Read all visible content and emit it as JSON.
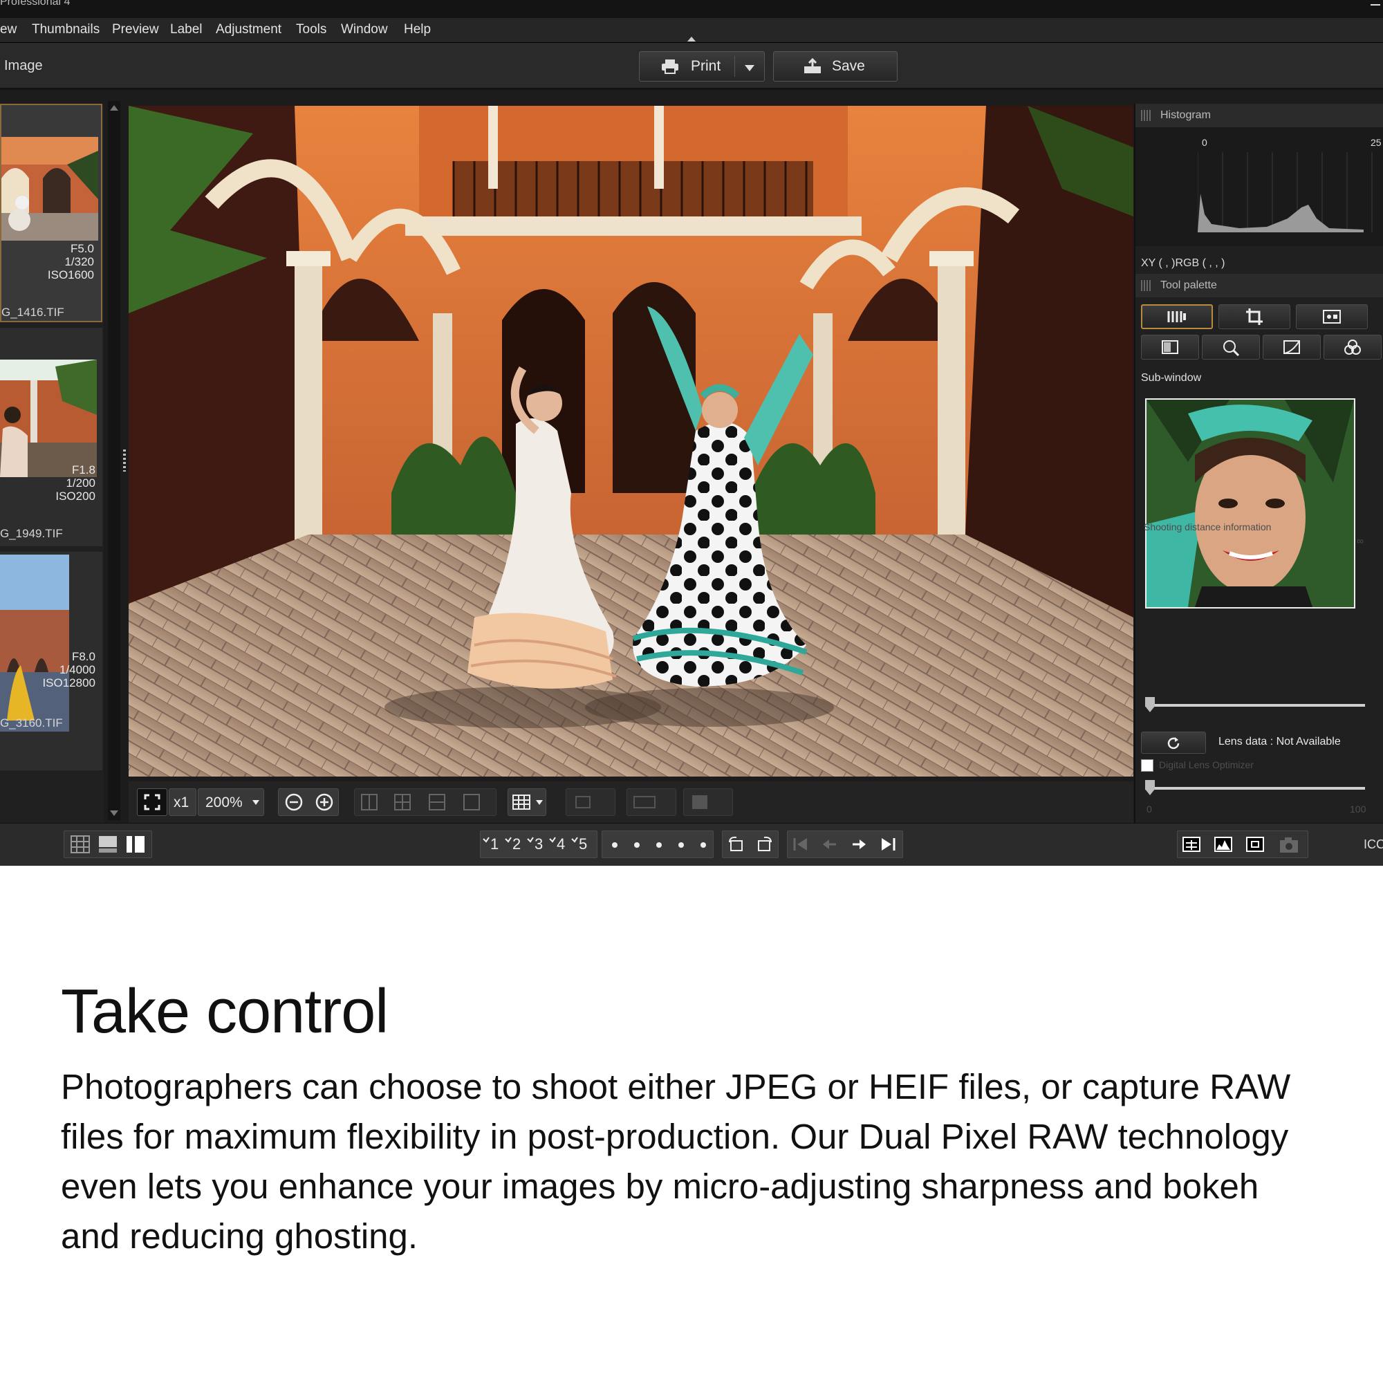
{
  "app": {
    "title_fragment": "Professional 4",
    "menu": [
      "ew",
      "Thumbnails",
      "Preview",
      "Label",
      "Adjustment",
      "Tools",
      "Window",
      "Help"
    ],
    "mode_label": "Image",
    "print_label": "Print",
    "save_label": "Save"
  },
  "thumbnails": [
    {
      "aperture": "F5.0",
      "shutter": "1/320",
      "iso": "ISO1600",
      "filename": "G_1416.TIF",
      "selected": true
    },
    {
      "aperture": "F1.8",
      "shutter": "1/200",
      "iso": "ISO200",
      "filename": "G_1949.TIF",
      "selected": false
    },
    {
      "aperture": "F8.0",
      "shutter": "1/4000",
      "iso": "ISO12800",
      "filename": "G_3160.TIF",
      "selected": false
    }
  ],
  "viewer_toolbar": {
    "zoom_factor": "x1",
    "zoom_level": "200%"
  },
  "panel": {
    "histogram_title": "Histogram",
    "histogram_min": "0",
    "histogram_max": "25",
    "xyrgb": "XY (    ,     )RGB (    ,    ,    )",
    "tool_palette_title": "Tool palette",
    "subwindow_label": "Sub-window",
    "shooting_distance": "Shooting distance information",
    "infinity": "∞",
    "lens_data": "Lens data : Not Available",
    "dlo_label": "Digital Lens Optimizer",
    "dlo_min": "0",
    "dlo_max": "100"
  },
  "statusbar": {
    "ratings": [
      "1",
      "2",
      "3",
      "4",
      "5"
    ],
    "icc": "ICC"
  },
  "heading": "Take control",
  "body": "Photographers can choose to shoot either JPEG or HEIF files, or capture RAW files for maximum flexibility in post-production. Our Dual Pixel RAW technology even lets you enhance your images by micro-adjusting sharpness and bokeh and reducing ghosting.",
  "colors": {
    "accent_selected": "#b88b3e",
    "app_bg": "#1c1c1c"
  }
}
